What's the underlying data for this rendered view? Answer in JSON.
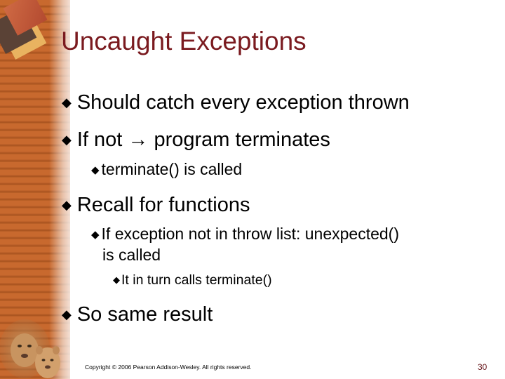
{
  "slide": {
    "title": "Uncaught Exceptions",
    "bullet_glyph": "◆",
    "arrow_glyph": "→",
    "bullets": [
      {
        "level": 1,
        "text": "Should catch every exception thrown"
      },
      {
        "level": 1,
        "text_before": "If not",
        "text_after": "program terminates"
      },
      {
        "level": 2,
        "text": "terminate() is called"
      },
      {
        "level": 1,
        "text": "Recall for functions"
      },
      {
        "level": 2,
        "text": "If exception not in throw list: unexpected()",
        "continuation": "is called"
      },
      {
        "level": 3,
        "text": "It in turn calls terminate()"
      },
      {
        "level": 1,
        "text": "So same result"
      }
    ],
    "footer": {
      "copyright": "Copyright © 2006 Pearson Addison-Wesley. All rights reserved.",
      "page_number": "30"
    },
    "colors": {
      "title": "#7a1a1f",
      "accent_stripe": "#c8692e"
    }
  }
}
